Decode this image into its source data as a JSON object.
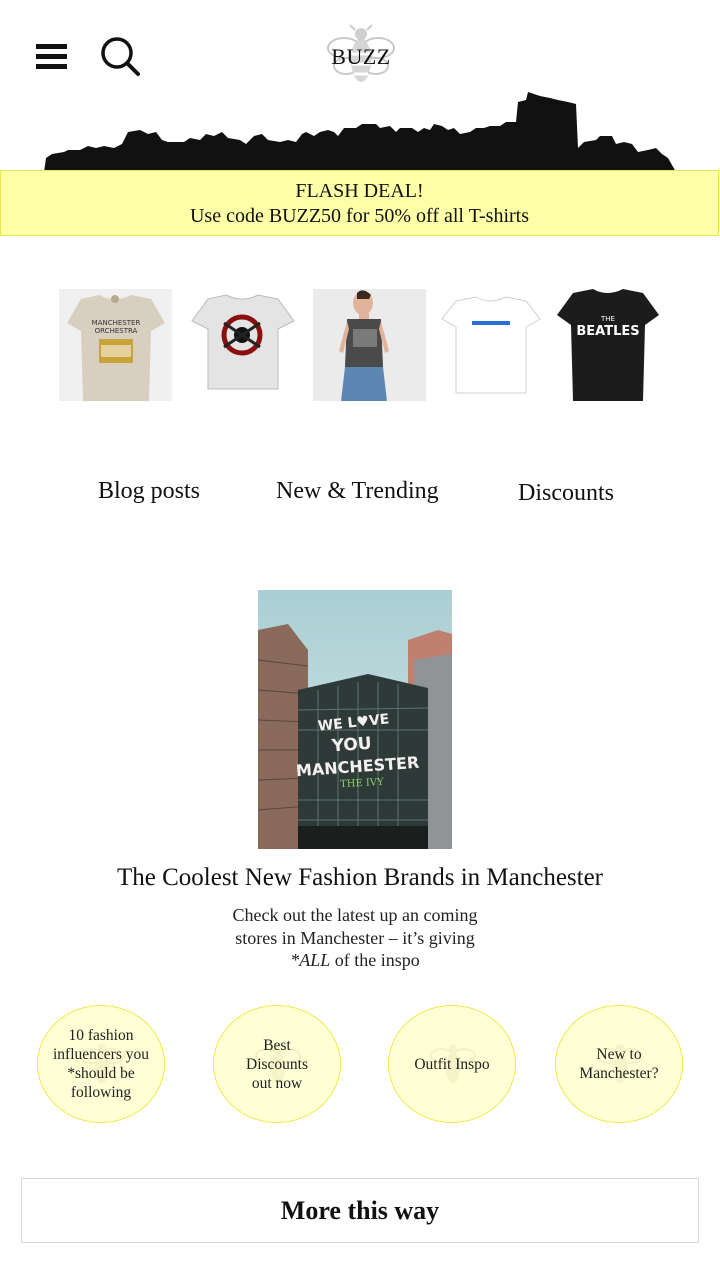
{
  "header": {
    "logo_text": "BUZZ",
    "menu_icon": "hamburger-menu-icon",
    "search_icon": "search-icon"
  },
  "flash_deal": {
    "title": "FLASH DEAL!",
    "message": "Use code BUZZ50  for 50% off all T-shirts"
  },
  "products": [
    {
      "name": "Manchester Orchestra t-shirt",
      "shirt_color": "#d9cfc0",
      "print_text": "MANCHESTER ORCHESTRA"
    },
    {
      "name": "Biohazard graphic t-shirt",
      "shirt_color": "#e4e4e4",
      "print_text": ""
    },
    {
      "name": "Grey tank top",
      "shirt_color": "#4a4a4a",
      "print_text": ""
    },
    {
      "name": "White slogan t-shirt",
      "shirt_color": "#ffffff",
      "print_text": ""
    },
    {
      "name": "The Beatles t-shirt",
      "shirt_color": "#1c1c1c",
      "print_text": "THE BEATLES"
    }
  ],
  "nav": {
    "blog": "Blog posts",
    "trending": "New & Trending",
    "discounts": "Discounts"
  },
  "article": {
    "title": "The Coolest New Fashion Brands in Manchester",
    "body_line1": "Check out the latest up an coming",
    "body_line2": "stores in Manchester – it’s giving",
    "body_line3_em": "*ALL",
    "body_line3_rest": " of the inspo",
    "hero_sign": [
      "WE LOVE",
      "YOU",
      "MANCHESTER",
      "THE IVY"
    ]
  },
  "bubbles": [
    {
      "label": "10 fashion influencers you *should be following"
    },
    {
      "label": "Best Discounts out now"
    },
    {
      "label": "Outfit Inspo"
    },
    {
      "label": "New to Manchester?"
    }
  ],
  "more_button": "More this way",
  "colors": {
    "flash_bg": "#ffffa8",
    "bubble_bg": "#ffffd6",
    "bubble_border": "#f0e84a",
    "skyline": "#111111"
  }
}
